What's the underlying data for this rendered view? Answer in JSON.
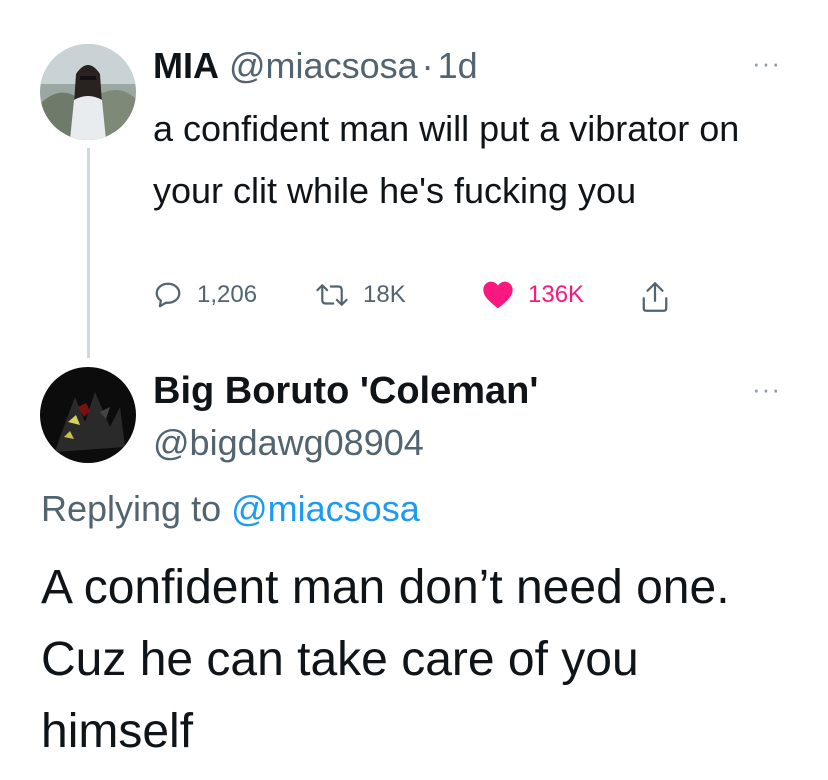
{
  "tweet": {
    "author_name": "MIA",
    "handle": "@miacsosa",
    "separator": "·",
    "time": "1d",
    "text": "a confident man will put a vibrator on your clit while he's fucking you",
    "metrics": {
      "replies": "1,206",
      "retweets": "18K",
      "likes": "136K"
    }
  },
  "reply": {
    "author_name": "Big Boruto 'Coleman'",
    "handle": "@bigdawg08904",
    "replying_prefix": "Replying to",
    "replying_handle": "@miacsosa",
    "text": "A confident man don’t need one. Cuz he can take care of you himself"
  },
  "more_label": "···",
  "colors": {
    "text": "#0f1419",
    "muted": "#536471",
    "link": "#1d9bf0",
    "like": "#f91880",
    "thread_line": "#cfd9de"
  }
}
